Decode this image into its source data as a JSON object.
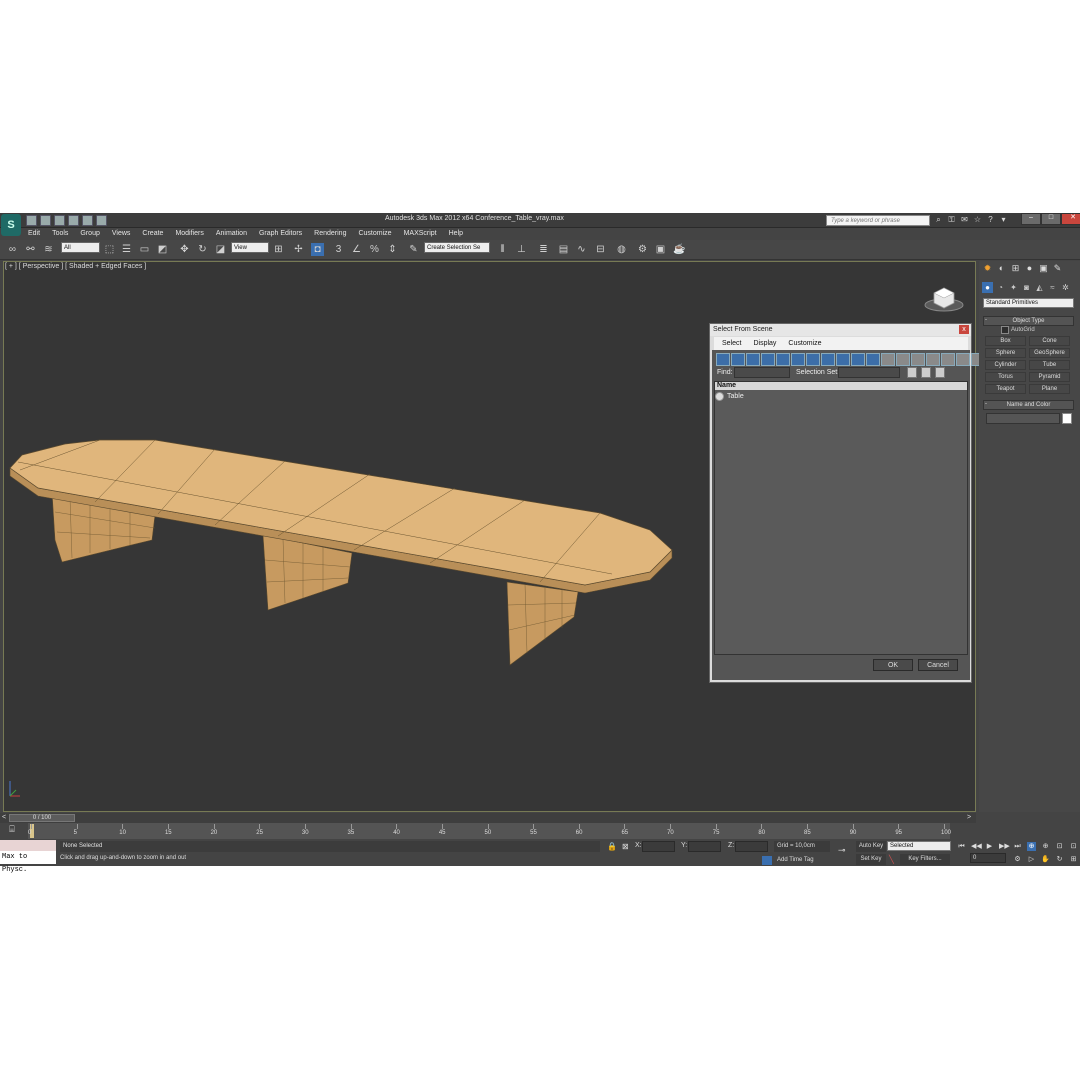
{
  "window": {
    "title": "Autodesk 3ds Max  2012 x64     Conference_Table_vray.max",
    "search_placeholder": "Type a keyword or phrase",
    "logo": "3ds-max-logo"
  },
  "menu": [
    "Edit",
    "Tools",
    "Group",
    "Views",
    "Create",
    "Modifiers",
    "Animation",
    "Graph Editors",
    "Rendering",
    "Customize",
    "MAXScript",
    "Help"
  ],
  "toolbar": {
    "selection_filter": "All",
    "reference_coord": "View",
    "named_selection": "Create Selection Se"
  },
  "viewport": {
    "label": "[ + ] [ Perspective ] [ Shaded + Edged Faces ]"
  },
  "dialog": {
    "title": "Select From Scene",
    "close": "x",
    "menu": [
      "Select",
      "Display",
      "Customize"
    ],
    "find_label": "Find:",
    "selection_set_label": "Selection Set:",
    "list_header": "Name",
    "items": [
      "Table"
    ],
    "ok": "OK",
    "cancel": "Cancel"
  },
  "command_panel": {
    "dropdown": "Standard Primitives",
    "object_type": "Object Type",
    "autogrid": "AutoGrid",
    "rollout_mark": "-",
    "buttons": [
      "Box",
      "Cone",
      "Sphere",
      "GeoSphere",
      "Cylinder",
      "Tube",
      "Torus",
      "Pyramid",
      "Teapot",
      "Plane"
    ],
    "name_and_color": "Name and Color"
  },
  "timeline": {
    "slider": "0 / 100",
    "ticks": [
      "0",
      "5",
      "10",
      "15",
      "20",
      "25",
      "30",
      "35",
      "40",
      "45",
      "50",
      "55",
      "60",
      "65",
      "70",
      "75",
      "80",
      "85",
      "90",
      "95",
      "100"
    ]
  },
  "status": {
    "maxscript": "Max to Physc.",
    "selection": "None Selected",
    "prompt": "Click and drag up-and-down to zoom in and out",
    "x_label": "X:",
    "y_label": "Y:",
    "z_label": "Z:",
    "grid": "Grid = 10,0cm",
    "add_time_tag": "Add Time Tag",
    "auto_key": "Auto Key",
    "set_key": "Set Key",
    "key_mode": "Selected",
    "key_filters": "Key Filters...",
    "frame": "0"
  }
}
